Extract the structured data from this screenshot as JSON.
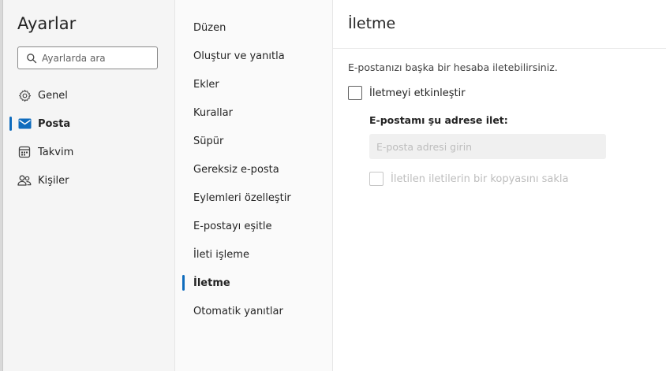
{
  "settings": {
    "title": "Ayarlar",
    "search_placeholder": "Ayarlarda ara",
    "nav": [
      {
        "label": "Genel",
        "icon": "gear-icon"
      },
      {
        "label": "Posta",
        "icon": "mail-icon",
        "active": true
      },
      {
        "label": "Takvim",
        "icon": "calendar-icon"
      },
      {
        "label": "Kişiler",
        "icon": "people-icon"
      }
    ]
  },
  "mail_settings": {
    "items": [
      "Düzen",
      "Oluştur ve yanıtla",
      "Ekler",
      "Kurallar",
      "Süpür",
      "Gereksiz e-posta",
      "Eylemleri özelleştir",
      "E-postayı eşitle",
      "İleti işleme",
      "İletme",
      "Otomatik yanıtlar"
    ],
    "active_index": 9
  },
  "forwarding": {
    "title": "İletme",
    "description": "E-postanızı başka bir hesaba iletebilirsiniz.",
    "enable_label": "İletmeyi etkinleştir",
    "enable_checked": false,
    "address_label": "E-postamı şu adrese ilet:",
    "address_placeholder": "E-posta adresi girin",
    "address_value": "",
    "keep_copy_label": "İletilen iletilerin bir kopyasını sakla",
    "keep_copy_checked": false
  },
  "colors": {
    "accent": "#0f6cbd",
    "text": "#242424",
    "disabled_text": "#bdbdbd"
  }
}
